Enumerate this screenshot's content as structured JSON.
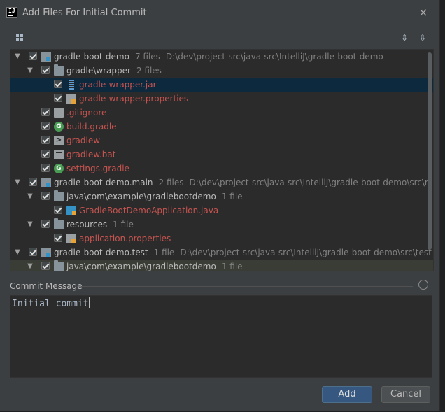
{
  "window": {
    "title": "Add Files For Initial Commit"
  },
  "icons": {
    "app": "IJ",
    "close": "×",
    "gradle": "G",
    "terminal": ">"
  },
  "tree": {
    "rows": [
      {
        "label": "gradle-boot-demo",
        "count": "7 files",
        "path": "D:\\dev\\project-src\\java-src\\IntelliJ\\gradle-boot-demo"
      },
      {
        "label": "gradle\\wrapper",
        "count": "2 files"
      },
      {
        "label": "gradle-wrapper.jar"
      },
      {
        "label": "gradle-wrapper.properties"
      },
      {
        "label": ".gitignore"
      },
      {
        "label": "build.gradle"
      },
      {
        "label": "gradlew"
      },
      {
        "label": "gradlew.bat"
      },
      {
        "label": "settings.gradle"
      },
      {
        "label": "gradle-boot-demo.main",
        "count": "2 files",
        "path": "D:\\dev\\project-src\\java-src\\IntelliJ\\gradle-boot-demo\\src\\ma"
      },
      {
        "label": "java\\com\\example\\gradlebootdemo",
        "count": "1 file"
      },
      {
        "label": "GradleBootDemoApplication.java"
      },
      {
        "label": "resources",
        "count": "1 file"
      },
      {
        "label": "application.properties"
      },
      {
        "label": "gradle-boot-demo.test",
        "count": "1 file",
        "path": "D:\\dev\\project-src\\java-src\\IntelliJ\\gradle-boot-demo\\src\\test"
      },
      {
        "label": "java\\com\\example\\gradlebootdemo",
        "count": "1 file"
      }
    ]
  },
  "commit": {
    "label": "Commit Message",
    "message": "Initial commit"
  },
  "buttons": {
    "add": "Add",
    "cancel": "Cancel"
  },
  "colors": {
    "accent": "#365880",
    "selection": "#0d293e",
    "unversioned": "#c75450",
    "background": "#3c3f41"
  }
}
